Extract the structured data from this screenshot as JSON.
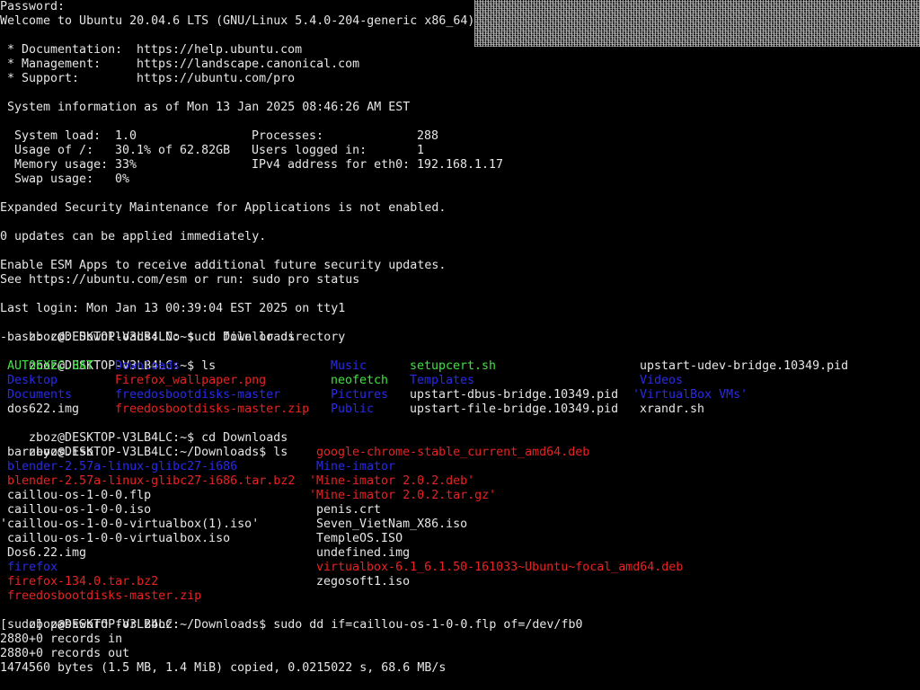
{
  "terminal": {
    "motd": {
      "l1": "Password:",
      "l2": "Welcome to Ubuntu 20.04.6 LTS (GNU/Linux 5.4.0-204-generic x86_64)",
      "doc_label": " * Documentation:",
      "doc_url": "https://help.ubuntu.com",
      "mgmt_label": " * Management:",
      "mgmt_url": "https://landscape.canonical.com",
      "support_label": " * Support:",
      "support_url": "https://ubuntu.com/pro",
      "sysinfo": " System information as of Mon 13 Jan 2025 08:46:26 AM EST",
      "load_label": "  System load:",
      "load_value": "1.0",
      "proc_label": "Processes:",
      "proc_value": "288",
      "usage_label": "  Usage of /:",
      "usage_value": "30.1% of 62.82GB",
      "users_label": "Users logged in:",
      "users_value": "1",
      "mem_label": "  Memory usage:",
      "mem_value": "33%",
      "ipv4_label": "IPv4 address for eth0:",
      "ipv4_value": "192.168.1.17",
      "swap_label": "  Swap usage:",
      "swap_value": "0%",
      "esm": "Expanded Security Maintenance for Applications is not enabled.",
      "updates": "0 updates can be applied immediately.",
      "esm_apps1": "Enable ESM Apps to receive additional future security updates.",
      "esm_apps2": "See https://ubuntu.com/esm or run: sudo pro status",
      "last_login": "Last login: Mon Jan 13 00:39:04 EST 2025 on tty1"
    },
    "session": {
      "prompt_home": "zboz@DESKTOP-V3LB4LC:~$",
      "prompt_downloads": "zboz@DESKTOP-V3LB4LC:~/Downloads$",
      "cmd1": " cd Downlloads",
      "err1": "-bash: cd: Downlloads: No such file or directory",
      "cmd2": " ls",
      "cmd3": " cd Downloads",
      "cmd4": " ls",
      "cmd5": " sudo dd if=caillou-os-1-0-0.flp of=/dev/fb0",
      "sudo_prompt": "[sudo] password for zboz:",
      "rec_in": "2880+0 records in",
      "rec_out": "2880+0 records out",
      "bytes": "1474560 bytes (1.5 MB, 1.4 MiB) copied, 0.0215022 s, 68.6 MB/s"
    },
    "home_listing": [
      [
        "AUTOEXEC.BAT",
        "Downloads",
        "Music",
        "setupcert.sh",
        "upstart-udev-bridge.10349.pid"
      ],
      [
        "Desktop",
        "Firefox_wallpaper.png",
        "neofetch",
        "Templates",
        "Videos"
      ],
      [
        "Documents",
        "freedosbootdisks-master",
        "Pictures",
        "upstart-dbus-bridge.10349.pid",
        "'VirtualBox VMs'"
      ],
      [
        "dos622.img",
        "freedosbootdisks-master.zip",
        "Public",
        "upstart-file-bridge.10349.pid",
        "xrandr.sh"
      ]
    ],
    "downloads_listing_left": [
      " barneyos.iso",
      " blender-2.57a-linux-glibc27-i686",
      " blender-2.57a-linux-glibc27-i686.tar.bz2",
      " caillou-os-1-0-0.flp",
      " caillou-os-1-0-0.iso",
      "'caillou-os-1-0-0-virtualbox(1).iso'",
      " caillou-os-1-0-0-virtualbox.iso",
      " Dos6.22.img",
      " firefox",
      " firefox-134.0.tar.bz2",
      " freedosbootdisks-master.zip"
    ],
    "downloads_listing_right": [
      " google-chrome-stable_current_amd64.deb",
      " Mine-imator",
      "'Mine-imator 2.0.2.deb'",
      "'Mine-imator 2.0.2.tar.gz'",
      " penis.crt",
      " Seven_VietNam_X86.iso",
      " TempleOS.ISO",
      " undefined.img",
      " virtualbox-6.1_6.1.50-161033~Ubuntu~focal_amd64.deb",
      " zegosoft1.iso"
    ],
    "colors": {
      "foreground": "#e6e6e6",
      "background": "#000000",
      "executable": "#3fe23f",
      "directory": "#2a2ae8",
      "archive": "#e82222"
    }
  }
}
